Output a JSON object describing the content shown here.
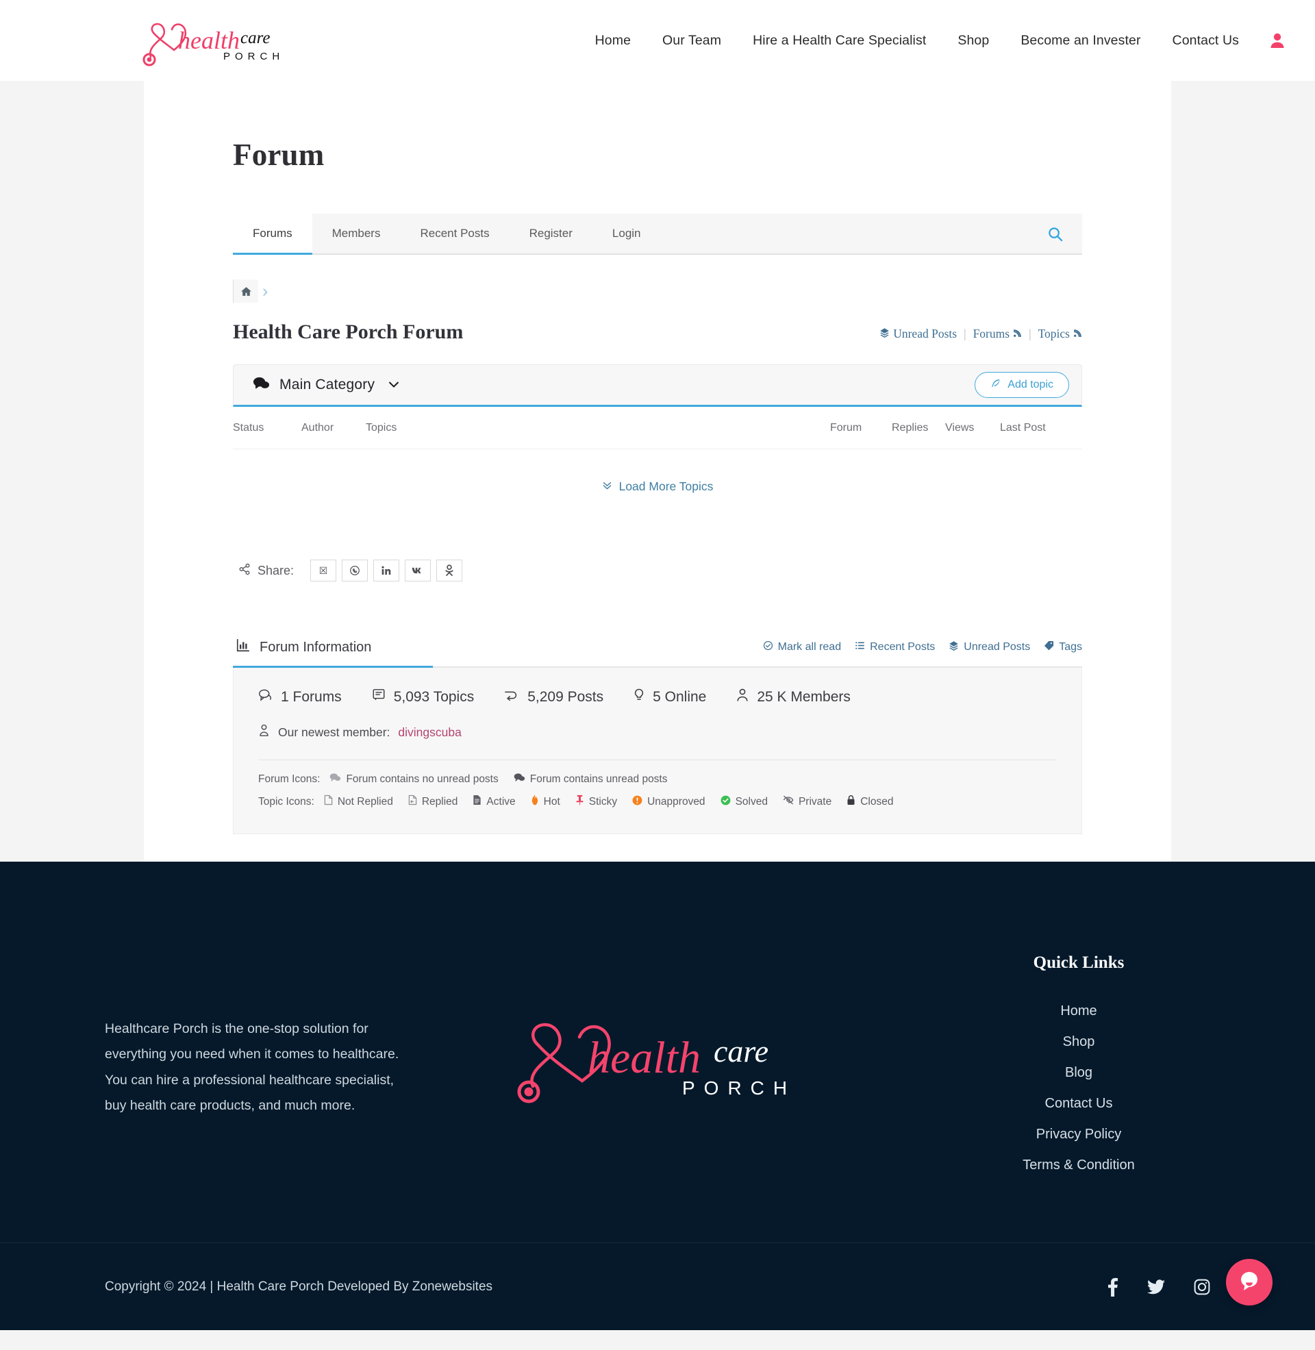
{
  "header": {
    "logo_alt": "health care PORCH",
    "nav": [
      {
        "label": "Home"
      },
      {
        "label": "Our Team"
      },
      {
        "label": "Hire a Health Care Specialist"
      },
      {
        "label": "Shop"
      },
      {
        "label": "Become an Invester"
      },
      {
        "label": "Contact Us"
      }
    ],
    "account_icon": "user-icon"
  },
  "page": {
    "title": "Forum"
  },
  "forum_tabs": [
    {
      "label": "Forums",
      "active": true
    },
    {
      "label": "Members",
      "active": false
    },
    {
      "label": "Recent Posts",
      "active": false
    },
    {
      "label": "Register",
      "active": false
    },
    {
      "label": "Login",
      "active": false
    }
  ],
  "search_icon": "search-icon",
  "breadcrumb": {
    "home_icon": "home-icon",
    "separator": "›"
  },
  "forum_header": {
    "name": "Health Care Porch Forum",
    "links": [
      {
        "label": "Unread Posts",
        "icon": "layers-icon"
      },
      {
        "label": "Forums",
        "icon": "rss-icon"
      },
      {
        "label": "Topics",
        "icon": "rss-icon"
      }
    ],
    "divider": "|"
  },
  "category": {
    "icon": "comments-icon",
    "title": "Main Category",
    "chevron": "⌄",
    "add_topic_label": "Add topic",
    "add_topic_icon": "feather-pen-icon"
  },
  "topics_table": {
    "columns": [
      "Status",
      "Author",
      "Topics",
      "Forum",
      "Replies",
      "Views",
      "Last Post"
    ],
    "rows": [],
    "load_more_label": "Load More Topics",
    "load_more_icon": "double-chevron-down-icon"
  },
  "share": {
    "label": "Share:",
    "icon": "share-nodes-icon",
    "buttons": [
      {
        "name": "x-twitter",
        "glyph": "☒"
      },
      {
        "name": "whatsapp",
        "glyph": "✆"
      },
      {
        "name": "linkedin",
        "glyph": "in"
      },
      {
        "name": "vk",
        "glyph": "ВК"
      },
      {
        "name": "odnoklassniki",
        "glyph": "☺"
      }
    ]
  },
  "forum_information": {
    "tab_label": "Forum Information",
    "tab_icon": "bar-chart-icon",
    "actions": [
      {
        "label": "Mark all read",
        "icon": "check-circle-icon"
      },
      {
        "label": "Recent Posts",
        "icon": "list-icon"
      },
      {
        "label": "Unread Posts",
        "icon": "layers-icon"
      },
      {
        "label": "Tags",
        "icon": "tag-icon"
      }
    ],
    "stats": [
      {
        "icon": "forum-bubble-icon",
        "value": "1 Forums"
      },
      {
        "icon": "topics-icon",
        "value": "5,093 Topics"
      },
      {
        "icon": "posts-icon",
        "value": "5,209 Posts"
      },
      {
        "icon": "online-icon",
        "value": "5 Online"
      },
      {
        "icon": "members-icon",
        "value": "25 K Members"
      }
    ],
    "newest_member": {
      "icon": "user-outline-icon",
      "prefix": "Our newest member:",
      "name": "divingscuba"
    },
    "forum_icons_label": "Forum Icons:",
    "forum_icons": [
      {
        "icon": "comments-grey-icon",
        "label": "Forum contains no unread posts"
      },
      {
        "icon": "comments-dark-icon",
        "label": "Forum contains unread posts"
      }
    ],
    "topic_icons_label": "Topic Icons:",
    "topic_icons": [
      {
        "icon": "file-blank-icon",
        "label": "Not Replied",
        "color": "#8e8e94"
      },
      {
        "icon": "file-reply-icon",
        "label": "Replied",
        "color": "#8e8e94"
      },
      {
        "icon": "file-lines-icon",
        "label": "Active",
        "color": "#5f5f66"
      },
      {
        "icon": "fire-icon",
        "label": "Hot",
        "color": "#f5821f"
      },
      {
        "icon": "pin-icon",
        "label": "Sticky",
        "color": "#e8415c"
      },
      {
        "icon": "exclamation-circle-icon",
        "label": "Unapproved",
        "color": "#f5821f"
      },
      {
        "icon": "check-circle-green-icon",
        "label": "Solved",
        "color": "#3bbf52"
      },
      {
        "icon": "eye-slash-icon",
        "label": "Private",
        "color": "#5f5f66"
      },
      {
        "icon": "lock-icon",
        "label": "Closed",
        "color": "#3a3a40"
      }
    ]
  },
  "footer": {
    "about": "Healthcare Porch is the one-stop solution for everything you need when it comes to healthcare. You can hire a professional healthcare specialist, buy health care products, and much more.",
    "logo_alt": "health care PORCH",
    "quick_links_title": "Quick Links",
    "quick_links": [
      {
        "label": "Home"
      },
      {
        "label": "Shop"
      },
      {
        "label": "Blog"
      },
      {
        "label": "Contact Us"
      },
      {
        "label": "Privacy Policy"
      },
      {
        "label": "Terms & Condition"
      }
    ],
    "copyright": "Copyright © 2024 | Health Care Porch Developed By Zonewebsites",
    "socials": [
      {
        "name": "facebook-icon"
      },
      {
        "name": "twitter-icon"
      },
      {
        "name": "instagram-icon"
      }
    ],
    "chat_icon": "chat-bubble-icon"
  },
  "colors": {
    "brand_pink": "#f5446c",
    "accent_blue": "#41a9dd",
    "footer_bg": "#05192b",
    "link_blue": "#3f6f92"
  }
}
